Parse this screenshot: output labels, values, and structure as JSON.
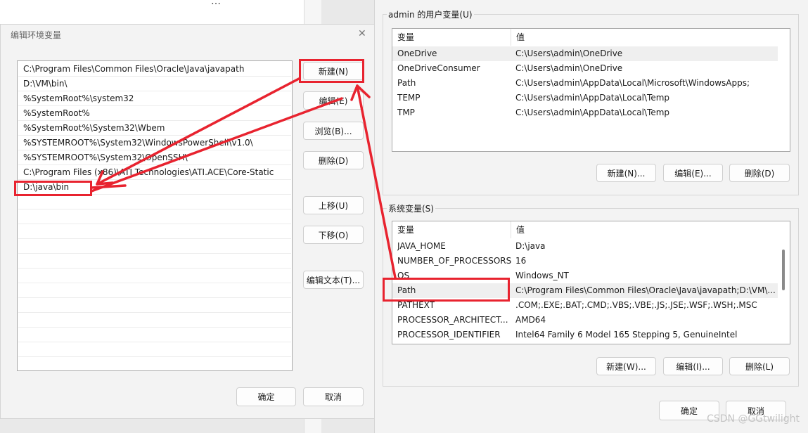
{
  "background": {
    "partial_text": "…"
  },
  "edit_dialog": {
    "title": "编辑环境变量",
    "close_glyph": "✕",
    "paths": [
      "C:\\Program Files\\Common Files\\Oracle\\Java\\javapath",
      "D:\\VM\\bin\\",
      "%SystemRoot%\\system32",
      "%SystemRoot%",
      "%SystemRoot%\\System32\\Wbem",
      "%SYSTEMROOT%\\System32\\WindowsPowerShell\\v1.0\\",
      "%SYSTEMROOT%\\System32\\OpenSSH\\",
      "C:\\Program Files (x86)\\ATI Technologies\\ATI.ACE\\Core-Static",
      "D:\\java\\bin"
    ],
    "buttons": {
      "new": "新建(N)",
      "edit": "编辑(E)",
      "browse": "浏览(B)...",
      "delete": "删除(D)",
      "move_up": "上移(U)",
      "move_down": "下移(O)",
      "edit_text": "编辑文本(T)...",
      "ok": "确定",
      "cancel": "取消"
    }
  },
  "env_dialog": {
    "user_vars": {
      "title": "admin 的用户变量(U)",
      "col_var": "变量",
      "col_val": "值",
      "rows": [
        {
          "name": "OneDrive",
          "value": "C:\\Users\\admin\\OneDrive"
        },
        {
          "name": "OneDriveConsumer",
          "value": "C:\\Users\\admin\\OneDrive"
        },
        {
          "name": "Path",
          "value": "C:\\Users\\admin\\AppData\\Local\\Microsoft\\WindowsApps;"
        },
        {
          "name": "TEMP",
          "value": "C:\\Users\\admin\\AppData\\Local\\Temp"
        },
        {
          "name": "TMP",
          "value": "C:\\Users\\admin\\AppData\\Local\\Temp"
        }
      ],
      "buttons": {
        "new": "新建(N)...",
        "edit": "编辑(E)...",
        "delete": "删除(D)"
      }
    },
    "sys_vars": {
      "title": "系统变量(S)",
      "col_var": "变量",
      "col_val": "值",
      "rows": [
        {
          "name": "JAVA_HOME",
          "value": "D:\\java"
        },
        {
          "name": "NUMBER_OF_PROCESSORS",
          "value": "16"
        },
        {
          "name": "OS",
          "value": "Windows_NT"
        },
        {
          "name": "Path",
          "value": "C:\\Program Files\\Common Files\\Oracle\\Java\\javapath;D:\\VM\\..."
        },
        {
          "name": "PATHEXT",
          "value": ".COM;.EXE;.BAT;.CMD;.VBS;.VBE;.JS;.JSE;.WSF;.WSH;.MSC"
        },
        {
          "name": "PROCESSOR_ARCHITECT...",
          "value": "AMD64"
        },
        {
          "name": "PROCESSOR_IDENTIFIER",
          "value": "Intel64 Family 6 Model 165 Stepping 5, GenuineIntel"
        }
      ],
      "buttons": {
        "new": "新建(W)...",
        "edit": "编辑(I)...",
        "delete": "删除(L)"
      }
    },
    "ok": "确定",
    "cancel": "取消"
  },
  "watermark": "CSDN @GGtwilight",
  "colors": {
    "annotation_red": "#e8232f",
    "selected_row": "#e5f1fb",
    "hover_row": "#efefef"
  }
}
